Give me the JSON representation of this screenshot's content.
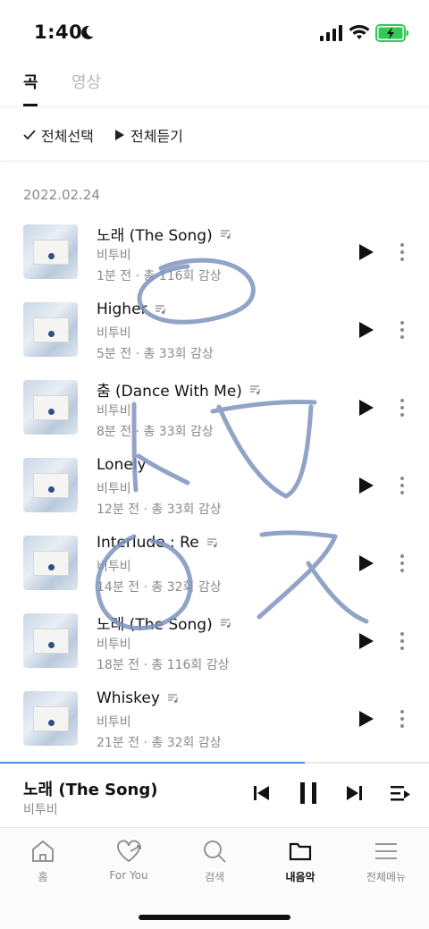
{
  "status_bar": {
    "time": "1:40"
  },
  "tabs": [
    {
      "label": "곡",
      "active": true
    },
    {
      "label": "영상",
      "active": false
    }
  ],
  "actions": {
    "select_all": "전체선택",
    "play_all": "전체듣기"
  },
  "date": "2022.02.24",
  "tracks": [
    {
      "title": "노래 (The Song)",
      "artist": "비투비",
      "meta": "1분 전 · 총 116회 감상",
      "has_lyrics": true
    },
    {
      "title": "Higher",
      "artist": "비투비",
      "meta": "5분 전 · 총 33회 감상",
      "has_lyrics": true
    },
    {
      "title": "춤 (Dance With Me)",
      "artist": "비투비",
      "meta": "8분 전 · 총 33회 감상",
      "has_lyrics": true
    },
    {
      "title": "Lonely",
      "artist": "비투비",
      "meta": "12분 전 · 총 33회 감상",
      "has_lyrics": false
    },
    {
      "title": "Interlude : Re",
      "artist": "비투비",
      "meta": "14분 전 · 총 32회 감상",
      "has_lyrics": true
    },
    {
      "title": "노래 (The Song)",
      "artist": "비투비",
      "meta": "18분 전 · 총 116회 감상",
      "has_lyrics": true
    },
    {
      "title": "Whiskey",
      "artist": "비투비",
      "meta": "21분 전 · 총 32회 감상",
      "has_lyrics": true
    }
  ],
  "player": {
    "title": "노래 (The Song)",
    "artist": "비투비",
    "progress": 0.71
  },
  "nav": [
    {
      "label": "홈",
      "icon": "home-icon",
      "active": false
    },
    {
      "label": "For You",
      "icon": "heart-icon",
      "active": false
    },
    {
      "label": "검색",
      "icon": "search-icon",
      "active": false
    },
    {
      "label": "내음악",
      "icon": "folder-icon",
      "active": true
    },
    {
      "label": "전체메뉴",
      "icon": "menu-icon",
      "active": false
    }
  ],
  "colors": {
    "accent": "#4a8fe7",
    "scribble": "#7e93bd",
    "muted": "#8a8a8a"
  }
}
